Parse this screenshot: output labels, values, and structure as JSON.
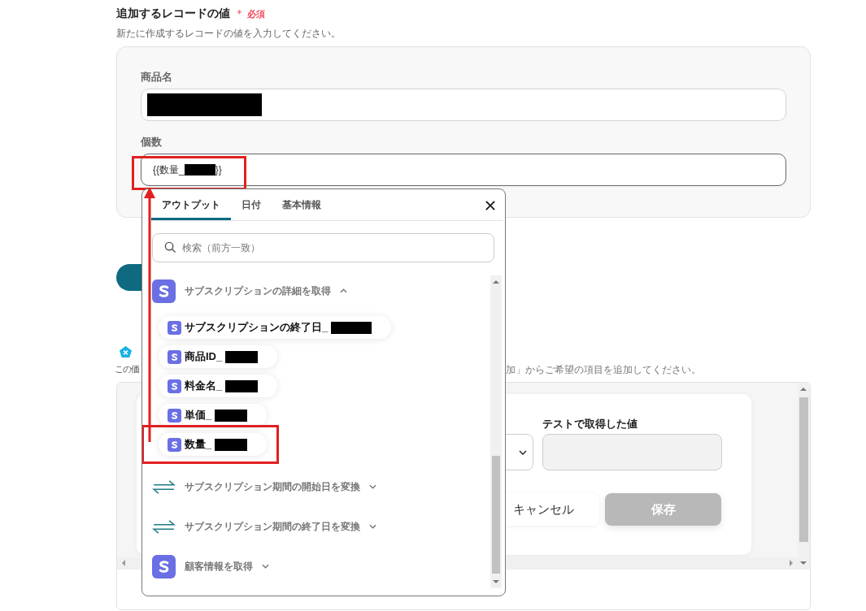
{
  "section": {
    "title": "追加するレコードの値",
    "required_mark": "＊",
    "required": "必須",
    "hint": "新たに作成するレコードの値を入力してください。"
  },
  "fields": [
    {
      "label": "商品名",
      "annotated": false
    },
    {
      "label": "個数",
      "value_before": "{{数量_",
      "value_after": "}}",
      "annotated": true
    }
  ],
  "lower": {
    "note_left": "この価",
    "note_right": "加」からご希望の項目を追加してください。",
    "test_label": "テストで取得した値",
    "buttons": [
      {
        "label": "キャンセル",
        "disabled": false
      },
      {
        "label": "保存",
        "disabled": true
      }
    ]
  },
  "popup": {
    "tabs": [
      {
        "label": "アウトプット",
        "selected": true
      },
      {
        "label": "日付",
        "selected": false
      },
      {
        "label": "基本情報",
        "selected": false
      }
    ],
    "search": {
      "placeholder": "検索（前方一致）"
    },
    "groups": [
      {
        "kind": "app",
        "title": "サブスクリプションの詳細を取得",
        "expanded": true,
        "items": [
          {
            "label": "サブスクリプションの終了日_",
            "annotated": false
          },
          {
            "label": "商品ID_",
            "annotated": false
          },
          {
            "label": "料金名_",
            "annotated": false
          },
          {
            "label": "単価_",
            "annotated": false
          },
          {
            "label": "数量_",
            "annotated": true
          }
        ]
      },
      {
        "kind": "convert",
        "title": "サブスクリプション期間の開始日を変換",
        "expanded": false
      },
      {
        "kind": "convert",
        "title": "サブスクリプション期間の終了日を変換",
        "expanded": false
      },
      {
        "kind": "app",
        "title": "顧客情報を取得",
        "expanded": false
      }
    ]
  }
}
